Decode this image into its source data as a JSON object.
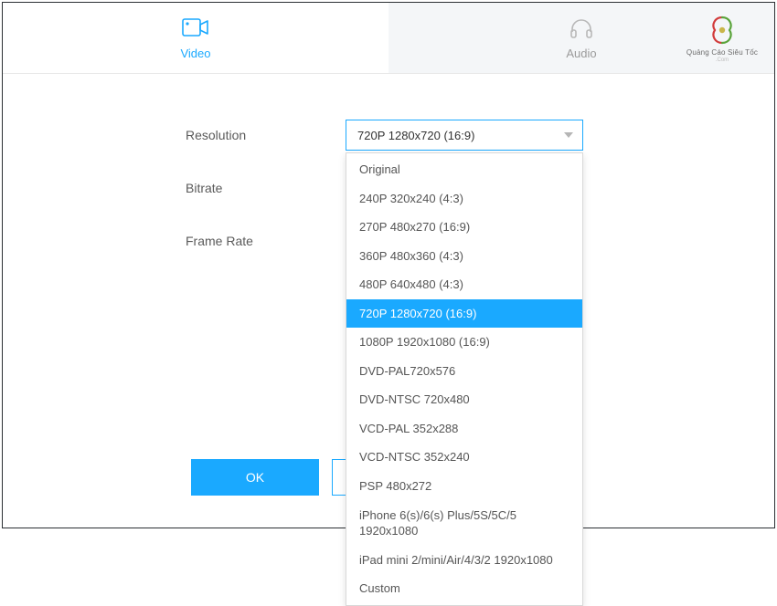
{
  "tabs": {
    "video": "Video",
    "audio": "Audio"
  },
  "logo": {
    "text": "Quảng Cáo Siêu Tốc",
    "sub": ".Com"
  },
  "labels": {
    "resolution": "Resolution",
    "bitrate": "Bitrate",
    "frame_rate": "Frame Rate"
  },
  "resolution": {
    "selected": "720P 1280x720 (16:9)",
    "options": [
      "Original",
      "240P 320x240 (4:3)",
      "270P 480x270 (16:9)",
      "360P 480x360 (4:3)",
      "480P 640x480 (4:3)",
      "720P 1280x720 (16:9)",
      "1080P 1920x1080 (16:9)",
      "DVD-PAL720x576",
      "DVD-NTSC 720x480",
      "VCD-PAL 352x288",
      "VCD-NTSC 352x240",
      "PSP 480x272",
      "iPhone 6(s)/6(s) Plus/5S/5C/5 1920x1080",
      "iPad mini 2/mini/Air/4/3/2 1920x1080",
      "Custom"
    ],
    "selected_index": 5
  },
  "buttons": {
    "ok": "OK"
  }
}
